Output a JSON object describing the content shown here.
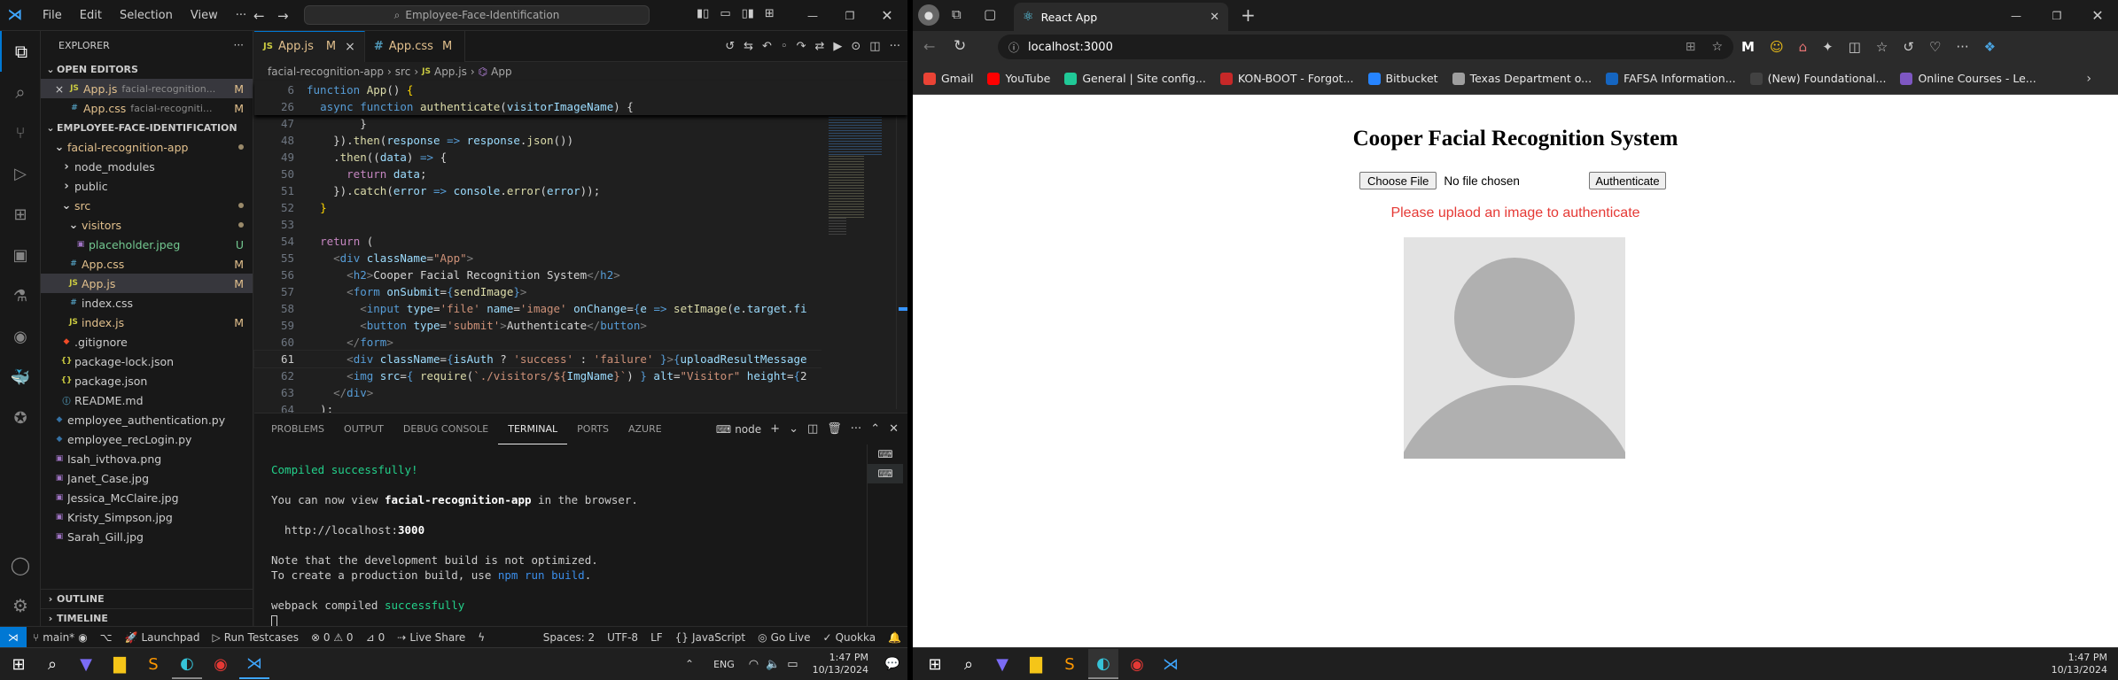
{
  "vscode": {
    "menu": [
      "File",
      "Edit",
      "Selection",
      "View",
      "···"
    ],
    "search": "Employee-Face-Identification",
    "explorer_title": "EXPLORER",
    "open_editors_title": "OPEN EDITORS",
    "open_editors": [
      {
        "close": "×",
        "name": "App.js",
        "path": "facial-recognition...",
        "status": "M",
        "type": "js"
      },
      {
        "name": "App.css",
        "path": "facial-recogniti...",
        "status": "M",
        "type": "css"
      }
    ],
    "project_title": "EMPLOYEE-FACE-IDENTIFICATION",
    "tree": [
      {
        "name": "facial-recognition-app",
        "indent": 1,
        "kind": "folder-open",
        "status": "dot"
      },
      {
        "name": "node_modules",
        "indent": 2,
        "kind": "folder",
        "status": ""
      },
      {
        "name": "public",
        "indent": 2,
        "kind": "folder",
        "status": ""
      },
      {
        "name": "src",
        "indent": 2,
        "kind": "folder-open",
        "status": "dot"
      },
      {
        "name": "visitors",
        "indent": 3,
        "kind": "folder-open",
        "status": "dot"
      },
      {
        "name": "placeholder.jpeg",
        "indent": 4,
        "kind": "img",
        "status": "U"
      },
      {
        "name": "App.css",
        "indent": 3,
        "kind": "css",
        "status": "M"
      },
      {
        "name": "App.js",
        "indent": 3,
        "kind": "js",
        "status": "M"
      },
      {
        "name": "index.css",
        "indent": 3,
        "kind": "css",
        "status": ""
      },
      {
        "name": "index.js",
        "indent": 3,
        "kind": "js",
        "status": "M"
      },
      {
        "name": ".gitignore",
        "indent": 2,
        "kind": "git",
        "status": ""
      },
      {
        "name": "package-lock.json",
        "indent": 2,
        "kind": "json",
        "status": ""
      },
      {
        "name": "package.json",
        "indent": 2,
        "kind": "json",
        "status": ""
      },
      {
        "name": "README.md",
        "indent": 2,
        "kind": "md",
        "status": ""
      },
      {
        "name": "employee_authentication.py",
        "indent": 1,
        "kind": "py",
        "status": ""
      },
      {
        "name": "employee_recLogin.py",
        "indent": 1,
        "kind": "py",
        "status": ""
      },
      {
        "name": "Isah_ivthova.png",
        "indent": 1,
        "kind": "img",
        "status": ""
      },
      {
        "name": "Janet_Case.jpg",
        "indent": 1,
        "kind": "img",
        "status": ""
      },
      {
        "name": "Jessica_McClaire.jpg",
        "indent": 1,
        "kind": "img",
        "status": ""
      },
      {
        "name": "Kristy_Simpson.jpg",
        "indent": 1,
        "kind": "img",
        "status": ""
      },
      {
        "name": "Sarah_Gill.jpg",
        "indent": 1,
        "kind": "img",
        "status": ""
      }
    ],
    "outline": "OUTLINE",
    "timeline": "TIMELINE",
    "tabs": [
      {
        "icon": "JS",
        "name": "App.js",
        "status": "M",
        "close": "×",
        "active": true
      },
      {
        "icon": "#",
        "name": "App.css",
        "status": "M",
        "active": false
      }
    ],
    "breadcrumb": [
      "facial-recognition-app",
      "src",
      "App.js",
      "App"
    ],
    "sticky": [
      {
        "ln": "6",
        "html": "<span class='kw'>function</span> <span class='fn'>App</span><span class='txt'>() </span><span class='br'>{</span>"
      },
      {
        "ln": "26",
        "html": "  <span class='kw'>async</span> <span class='kw'>function</span> <span class='fn'>authenticate</span><span class='txt'>(</span><span class='var'>visitorImageName</span><span class='txt'>) {</span>"
      }
    ],
    "code": [
      {
        "ln": "47",
        "html": "        <span class='txt'>}</span>"
      },
      {
        "ln": "48",
        "html": "    <span class='txt'>}).</span><span class='fn'>then</span><span class='txt'>(</span><span class='var'>response</span> <span class='kw'>=&gt;</span> <span class='var'>response</span><span class='txt'>.</span><span class='fn'>json</span><span class='txt'>())</span>"
      },
      {
        "ln": "49",
        "html": "    <span class='txt'>.</span><span class='fn'>then</span><span class='txt'>((</span><span class='var'>data</span><span class='txt'>) </span><span class='kw'>=&gt;</span> <span class='txt'>{</span>"
      },
      {
        "ln": "50",
        "html": "      <span class='ctrl'>return</span> <span class='var'>data</span><span class='txt'>;</span>"
      },
      {
        "ln": "51",
        "html": "    <span class='txt'>}).</span><span class='fn'>catch</span><span class='txt'>(</span><span class='var'>error</span> <span class='kw'>=&gt;</span> <span class='var'>console</span><span class='txt'>.</span><span class='fn'>error</span><span class='txt'>(</span><span class='var'>error</span><span class='txt'>));</span>"
      },
      {
        "ln": "52",
        "html": "  <span class='br'>}</span>"
      },
      {
        "ln": "53",
        "html": ""
      },
      {
        "ln": "54",
        "html": "  <span class='ctrl'>return</span> <span class='txt'>(</span>"
      },
      {
        "ln": "55",
        "html": "    <span class='lt'>&lt;</span><span class='tag'>div</span> <span class='attr'>className</span><span class='txt'>=</span><span class='str'>\"App\"</span><span class='lt'>&gt;</span>"
      },
      {
        "ln": "56",
        "html": "      <span class='lt'>&lt;</span><span class='tag'>h2</span><span class='lt'>&gt;</span><span class='txt'>Cooper Facial Recognition System</span><span class='lt'>&lt;/</span><span class='tag'>h2</span><span class='lt'>&gt;</span>"
      },
      {
        "ln": "57",
        "html": "      <span class='lt'>&lt;</span><span class='tag'>form</span> <span class='attr'>onSubmit</span><span class='txt'>=</span><span class='kw'>{</span><span class='fn'>sendImage</span><span class='kw'>}</span><span class='lt'>&gt;</span>"
      },
      {
        "ln": "58",
        "html": "        <span class='lt'>&lt;</span><span class='tag'>input</span> <span class='attr'>type</span><span class='txt'>=</span><span class='str'>'file'</span> <span class='attr'>name</span><span class='txt'>=</span><span class='str'>'image'</span> <span class='attr'>onChange</span><span class='txt'>=</span><span class='kw'>{</span><span class='var'>e</span> <span class='kw'>=&gt;</span> <span class='fn'>setImage</span><span class='txt'>(</span><span class='var'>e</span><span class='txt'>.</span><span class='var'>target</span><span class='txt'>.</span><span class='var'>fi</span>"
      },
      {
        "ln": "59",
        "html": "        <span class='lt'>&lt;</span><span class='tag'>button</span> <span class='attr'>type</span><span class='txt'>=</span><span class='str'>'submit'</span><span class='lt'>&gt;</span><span class='txt'>Authenticate</span><span class='lt'>&lt;/</span><span class='tag'>button</span><span class='lt'>&gt;</span>"
      },
      {
        "ln": "60",
        "html": "      <span class='lt'>&lt;/</span><span class='tag'>form</span><span class='lt'>&gt;</span>"
      },
      {
        "ln": "61",
        "html": "      <span class='lt'>&lt;</span><span class='tag'>div</span> <span class='attr'>className</span><span class='txt'>=</span><span class='kw'>{</span><span class='var'>isAuth</span> <span class='txt'>?</span> <span class='str'>'success'</span> <span class='txt'>:</span> <span class='str'>'failure'</span> <span class='kw'>}</span><span class='lt'>&gt;</span><span class='kw'>{</span><span class='var'>uploadResultMessage</span>"
      },
      {
        "ln": "62",
        "html": "      <span class='lt'>&lt;</span><span class='tag'>img</span> <span class='attr'>src</span><span class='txt'>=</span><span class='kw'>{</span> <span class='fn'>require</span><span class='txt'>(</span><span class='str'>`./visitors/${</span><span class='var'>ImgName</span><span class='str'>}`</span><span class='txt'>)</span> <span class='kw'>}</span> <span class='attr'>alt</span><span class='txt'>=</span><span class='str'>\"Visitor\"</span> <span class='attr'>height</span><span class='txt'>=</span><span class='kw'>{</span><span class='txt'>2</span>"
      },
      {
        "ln": "63",
        "html": "    <span class='lt'>&lt;/</span><span class='tag'>div</span><span class='lt'>&gt;</span>"
      },
      {
        "ln": "64",
        "html": "  <span class='txt'>);</span>"
      }
    ],
    "panel_tabs": [
      "PROBLEMS",
      "OUTPUT",
      "DEBUG CONSOLE",
      "TERMINAL",
      "PORTS",
      "AZURE"
    ],
    "panel_active": "TERMINAL",
    "terminal_shell": "node",
    "terminal": {
      "compiled": "Compiled successfully!",
      "view_prefix": "You can now view ",
      "view_app": "facial-recognition-app",
      "view_suffix": " in the browser.",
      "url_prefix": "  http://localhost:",
      "url_port": "3000",
      "note1": "Note that the development build is not optimized.",
      "note2_prefix": "To create a production build, use ",
      "note2_cmd": "npm run build",
      "note2_suffix": ".",
      "webpack_prefix": "webpack compiled ",
      "webpack_status": "successfully"
    },
    "status": {
      "branch": "main*",
      "launchpad": "Launchpad",
      "testcases": "Run Testcases",
      "errors": "⊗ 0 ⚠ 0",
      "ports": "0",
      "liveshare": "Live Share",
      "spaces": "Spaces: 2",
      "encoding": "UTF-8",
      "eol": "LF",
      "lang": "JavaScript",
      "golive": "Go Live",
      "quokka": "Quokka"
    }
  },
  "browser": {
    "tab_title": "React App",
    "url": "localhost:3000",
    "bookmarks": [
      {
        "label": "Gmail",
        "color": "#ea4335"
      },
      {
        "label": "YouTube",
        "color": "#ff0000"
      },
      {
        "label": "General | Site config...",
        "color": "#20c997"
      },
      {
        "label": "KON-BOOT - Forgot...",
        "color": "#c62828"
      },
      {
        "label": "Bitbucket",
        "color": "#2684ff"
      },
      {
        "label": "Texas Department o...",
        "color": "#9e9e9e"
      },
      {
        "label": "FAFSA Information...",
        "color": "#1565c0"
      },
      {
        "label": "(New) Foundational...",
        "color": "#424242"
      },
      {
        "label": "Online Courses - Le...",
        "color": "#7e57c2"
      }
    ],
    "page": {
      "heading": "Cooper Facial Recognition System",
      "choose_file": "Choose File",
      "no_file": "No file chosen",
      "authenticate": "Authenticate",
      "message": "Please uplaod an image to authenticate",
      "message_color": "#e53935"
    }
  },
  "taskbar_left": {
    "lang": "ENG",
    "time": "1:47 PM",
    "date": "10/13/2024"
  },
  "taskbar_right": {
    "time": "1:47 PM",
    "date": "10/13/2024"
  }
}
